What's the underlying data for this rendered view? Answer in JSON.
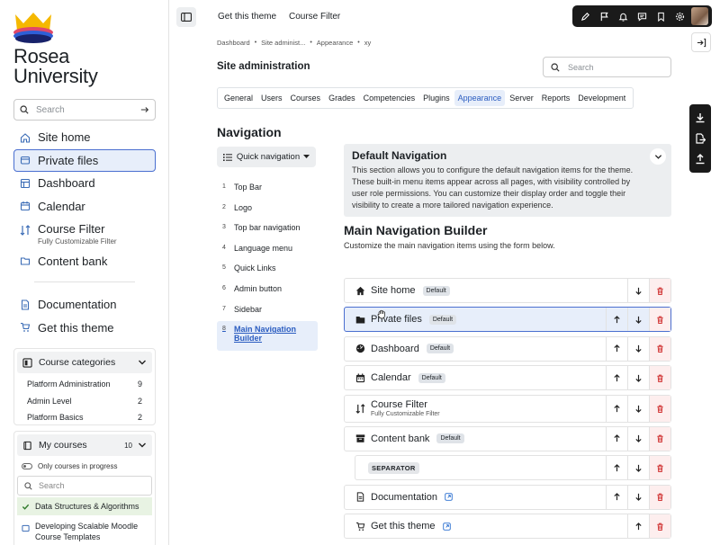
{
  "brand": {
    "line1": "Rosea",
    "line2": "University"
  },
  "sidebar": {
    "search_placeholder": "Search",
    "items": [
      {
        "label": "Site home",
        "icon": "home-icon"
      },
      {
        "label": "Private files",
        "icon": "folder-icon",
        "active": true
      },
      {
        "label": "Dashboard",
        "icon": "dashboard-icon"
      },
      {
        "label": "Calendar",
        "icon": "calendar-icon"
      },
      {
        "label": "Course Filter",
        "sub": "Fully Customizable Filter",
        "icon": "filter-icon"
      },
      {
        "label": "Content bank",
        "icon": "folder-icon"
      }
    ],
    "items2": [
      {
        "label": "Documentation",
        "icon": "document-icon"
      },
      {
        "label": "Get this theme",
        "icon": "cart-icon"
      }
    ],
    "categories": {
      "title": "Course categories",
      "rows": [
        {
          "name": "Platform Administration",
          "count": "9"
        },
        {
          "name": "Admin Level",
          "count": "2"
        },
        {
          "name": "Platform Basics",
          "count": "2"
        }
      ]
    },
    "my_courses": {
      "title": "My courses",
      "count": "10",
      "toggle_label": "Only courses in progress",
      "search_placeholder": "Search",
      "courses": [
        {
          "name": "Data Structures & Algorithms",
          "selected": true
        },
        {
          "name": "Developing Scalable Moodle Course Templates"
        }
      ]
    }
  },
  "topbar": {
    "link1": "Get this theme",
    "link2": "Course Filter"
  },
  "breadcrumb": [
    "Dashboard",
    "Site administ...",
    "Appearance",
    "xy"
  ],
  "page_title": "Site administration",
  "main_search_placeholder": "Search",
  "tabs": [
    "General",
    "Users",
    "Courses",
    "Grades",
    "Competencies",
    "Plugins",
    "Appearance",
    "Server",
    "Reports",
    "Development"
  ],
  "active_tab": "Appearance",
  "navigation": {
    "heading": "Navigation",
    "quick_nav_label": "Quick navigation",
    "list": [
      {
        "num": "1",
        "label": "Top Bar"
      },
      {
        "num": "2",
        "label": "Logo"
      },
      {
        "num": "3",
        "label": "Top bar navigation"
      },
      {
        "num": "4",
        "label": "Language menu"
      },
      {
        "num": "5",
        "label": "Quick Links"
      },
      {
        "num": "6",
        "label": "Admin button"
      },
      {
        "num": "7",
        "label": "Sidebar"
      },
      {
        "num": "8",
        "label": "Main Navigation Builder",
        "active": true
      }
    ]
  },
  "default_nav": {
    "title": "Default Navigation",
    "description": "This section allows you to configure the default navigation items for the theme. These built-in menu items appear across all pages, with visibility controlled by user role permissions. You can customize their display order and toggle their visibility to create a more tailored navigation experience."
  },
  "builder": {
    "heading": "Main Navigation Builder",
    "subtitle": "Customize the main navigation items using the form below.",
    "default_badge": "Default",
    "separator_label": "SEPARATOR",
    "rows": [
      {
        "label": "Site home",
        "badge": "Default",
        "icon": "home-icon"
      },
      {
        "label": "Private files",
        "badge": "Default",
        "icon": "folder-icon",
        "selected": true
      },
      {
        "label": "Dashboard",
        "badge": "Default",
        "icon": "dashboard-icon"
      },
      {
        "label": "Calendar",
        "badge": "Default",
        "icon": "calendar-icon"
      },
      {
        "label": "Course Filter",
        "sub": "Fully Customizable Filter",
        "icon": "filter-icon"
      },
      {
        "label": "Content bank",
        "badge": "Default",
        "icon": "box-icon"
      },
      {
        "separator": true
      },
      {
        "label": "Documentation",
        "icon": "document-icon",
        "external": true
      },
      {
        "label": "Get this theme",
        "icon": "cart-icon",
        "external": true
      }
    ]
  },
  "colors": {
    "accent": "#2a5cc0",
    "active_bg": "#e7eefa",
    "delete": "#d23a3a",
    "toolbar": "#1a1a1a"
  }
}
